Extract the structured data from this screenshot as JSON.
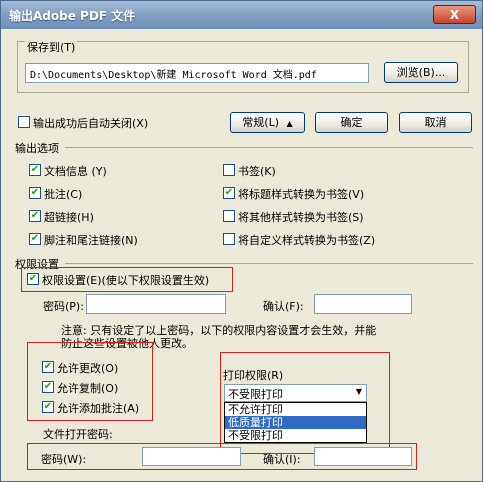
{
  "title": "输出Adobe PDF 文件",
  "close_glyph": "X",
  "save_to": {
    "label": "保存到(T)",
    "path": "D:\\Documents\\Desktop\\新建 Microsoft Word 文档.pdf",
    "browse": "浏览(B)..."
  },
  "auto_close": {
    "label": "输出成功后自动关闭(X)",
    "checked": false
  },
  "buttons": {
    "general": "常规(L)",
    "general_arrow": "▲",
    "ok": "确定",
    "cancel": "取消"
  },
  "output_options": {
    "heading": "输出选项",
    "left": [
      {
        "label": "文档信息 (Y)",
        "checked": true
      },
      {
        "label": "批注(C)",
        "checked": true
      },
      {
        "label": "超链接(H)",
        "checked": true
      },
      {
        "label": "脚注和尾注链接(N)",
        "checked": true
      }
    ],
    "right": [
      {
        "label": "书签(K)",
        "checked": false
      },
      {
        "label": "将标题样式转换为书签(V)",
        "checked": true
      },
      {
        "label": "将其他样式转换为书签(S)",
        "checked": false
      },
      {
        "label": "将自定义样式转换为书签(Z)",
        "checked": false
      }
    ]
  },
  "permissions": {
    "heading": "权限设置",
    "enable": {
      "label": "权限设置(E)(使以下权限设置生效)",
      "checked": true
    },
    "password_label": "密码(P):",
    "confirm_label": "确认(F):",
    "note_line1": "注意: 只有设定了以上密码，以下的权限内容设置才会生效，并能",
    "note_line2": "防止这些设置被他人更改。",
    "allow": [
      {
        "label": "允许更改(O)",
        "checked": true
      },
      {
        "label": "允许复制(O)",
        "checked": true
      },
      {
        "label": "允许添加批注(A)",
        "checked": true
      }
    ],
    "print": {
      "label": "打印权限(R)",
      "selected": "不受限打印",
      "arrow": "▼",
      "options": [
        "不允许打印",
        "低质量打印",
        "不受限打印"
      ],
      "highlighted_index": 1
    },
    "open_password_label": "文件打开密码:",
    "open_password_field": "密码(W):",
    "open_confirm_field": "确认(I):"
  },
  "colors": {
    "annotation": "#d62020",
    "check": "#21a121"
  }
}
